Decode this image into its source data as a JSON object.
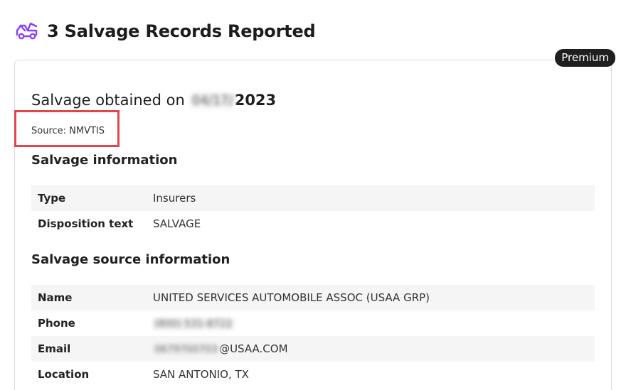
{
  "header": {
    "icon": "tow-truck-icon",
    "title": "3 Salvage Records Reported",
    "accent_color": "#8a3ffc"
  },
  "card": {
    "badge": "Premium",
    "salvage_prefix": "Salvage obtained on",
    "salvage_date_redacted": "04/17/",
    "salvage_year": "2023",
    "source": "Source: NMVTIS",
    "highlight_color": "#e0474c"
  },
  "salvage_info": {
    "title": "Salvage information",
    "rows": [
      {
        "label": "Type",
        "value": "Insurers"
      },
      {
        "label": "Disposition text",
        "value": "SALVAGE"
      }
    ]
  },
  "source_info": {
    "title": "Salvage source information",
    "name": {
      "label": "Name",
      "value": "UNITED SERVICES AUTOMOBILE ASSOC (USAA GRP)"
    },
    "phone": {
      "label": "Phone",
      "value_redacted": "(800) 531-8722"
    },
    "email": {
      "label": "Email",
      "value_redacted": "0679700703",
      "value_suffix": "@USAA.COM"
    },
    "location": {
      "label": "Location",
      "value": "SAN ANTONIO, TX"
    }
  }
}
